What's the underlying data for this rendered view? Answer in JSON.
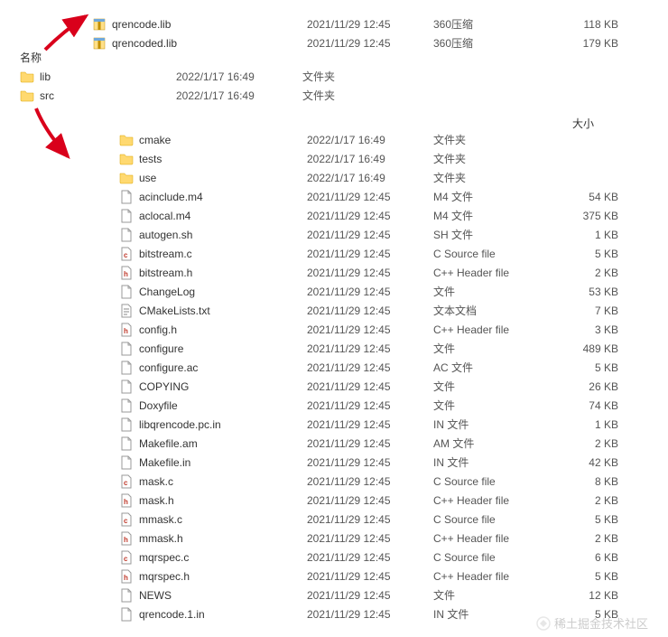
{
  "headers": {
    "name": "名称",
    "size": "大小"
  },
  "top_files": [
    {
      "name": "qrencode.lib",
      "date": "2021/11/29 12:45",
      "type": "360压缩",
      "size": "118 KB",
      "icon": "archive"
    },
    {
      "name": "qrencoded.lib",
      "date": "2021/11/29 12:45",
      "type": "360压缩",
      "size": "179 KB",
      "icon": "archive"
    }
  ],
  "top_folders": [
    {
      "name": "lib",
      "date": "2022/1/17 16:49",
      "type": "文件夹",
      "size": "",
      "icon": "folder"
    },
    {
      "name": "src",
      "date": "2022/1/17 16:49",
      "type": "文件夹",
      "size": "",
      "icon": "folder"
    }
  ],
  "inner_files": [
    {
      "name": "cmake",
      "date": "2022/1/17 16:49",
      "type": "文件夹",
      "size": "",
      "icon": "folder"
    },
    {
      "name": "tests",
      "date": "2022/1/17 16:49",
      "type": "文件夹",
      "size": "",
      "icon": "folder"
    },
    {
      "name": "use",
      "date": "2022/1/17 16:49",
      "type": "文件夹",
      "size": "",
      "icon": "folder"
    },
    {
      "name": "acinclude.m4",
      "date": "2021/11/29 12:45",
      "type": "M4 文件",
      "size": "54 KB",
      "icon": "file"
    },
    {
      "name": "aclocal.m4",
      "date": "2021/11/29 12:45",
      "type": "M4 文件",
      "size": "375 KB",
      "icon": "file"
    },
    {
      "name": "autogen.sh",
      "date": "2021/11/29 12:45",
      "type": "SH 文件",
      "size": "1 KB",
      "icon": "file"
    },
    {
      "name": "bitstream.c",
      "date": "2021/11/29 12:45",
      "type": "C Source file",
      "size": "5 KB",
      "icon": "cfile"
    },
    {
      "name": "bitstream.h",
      "date": "2021/11/29 12:45",
      "type": "C++ Header file",
      "size": "2 KB",
      "icon": "hfile"
    },
    {
      "name": "ChangeLog",
      "date": "2021/11/29 12:45",
      "type": "文件",
      "size": "53 KB",
      "icon": "file"
    },
    {
      "name": "CMakeLists.txt",
      "date": "2021/11/29 12:45",
      "type": "文本文档",
      "size": "7 KB",
      "icon": "txt"
    },
    {
      "name": "config.h",
      "date": "2021/11/29 12:45",
      "type": "C++ Header file",
      "size": "3 KB",
      "icon": "hfile"
    },
    {
      "name": "configure",
      "date": "2021/11/29 12:45",
      "type": "文件",
      "size": "489 KB",
      "icon": "file"
    },
    {
      "name": "configure.ac",
      "date": "2021/11/29 12:45",
      "type": "AC 文件",
      "size": "5 KB",
      "icon": "file"
    },
    {
      "name": "COPYING",
      "date": "2021/11/29 12:45",
      "type": "文件",
      "size": "26 KB",
      "icon": "file"
    },
    {
      "name": "Doxyfile",
      "date": "2021/11/29 12:45",
      "type": "文件",
      "size": "74 KB",
      "icon": "file"
    },
    {
      "name": "libqrencode.pc.in",
      "date": "2021/11/29 12:45",
      "type": "IN 文件",
      "size": "1 KB",
      "icon": "file"
    },
    {
      "name": "Makefile.am",
      "date": "2021/11/29 12:45",
      "type": "AM 文件",
      "size": "2 KB",
      "icon": "file"
    },
    {
      "name": "Makefile.in",
      "date": "2021/11/29 12:45",
      "type": "IN 文件",
      "size": "42 KB",
      "icon": "file"
    },
    {
      "name": "mask.c",
      "date": "2021/11/29 12:45",
      "type": "C Source file",
      "size": "8 KB",
      "icon": "cfile"
    },
    {
      "name": "mask.h",
      "date": "2021/11/29 12:45",
      "type": "C++ Header file",
      "size": "2 KB",
      "icon": "hfile"
    },
    {
      "name": "mmask.c",
      "date": "2021/11/29 12:45",
      "type": "C Source file",
      "size": "5 KB",
      "icon": "cfile"
    },
    {
      "name": "mmask.h",
      "date": "2021/11/29 12:45",
      "type": "C++ Header file",
      "size": "2 KB",
      "icon": "hfile"
    },
    {
      "name": "mqrspec.c",
      "date": "2021/11/29 12:45",
      "type": "C Source file",
      "size": "6 KB",
      "icon": "cfile"
    },
    {
      "name": "mqrspec.h",
      "date": "2021/11/29 12:45",
      "type": "C++ Header file",
      "size": "5 KB",
      "icon": "hfile"
    },
    {
      "name": "NEWS",
      "date": "2021/11/29 12:45",
      "type": "文件",
      "size": "12 KB",
      "icon": "file"
    },
    {
      "name": "qrencode.1.in",
      "date": "2021/11/29 12:45",
      "type": "IN 文件",
      "size": "5 KB",
      "icon": "file"
    }
  ],
  "watermark": "稀土掘金技术社区"
}
